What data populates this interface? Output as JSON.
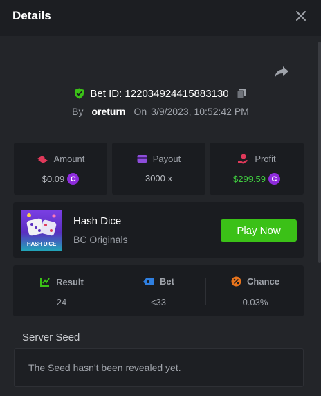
{
  "header": {
    "title": "Details"
  },
  "bet": {
    "id_label": "Bet ID: 122034924415883130",
    "by_label": "By",
    "user": "oreturn",
    "on_label": "On",
    "datetime": "3/9/2023, 10:52:42 PM"
  },
  "stats": {
    "amount_label": "Amount",
    "amount_value": "$0.09",
    "payout_label": "Payout",
    "payout_value": "3000 x",
    "profit_label": "Profit",
    "profit_value": "$299.59"
  },
  "game": {
    "name": "Hash Dice",
    "provider": "BC Originals",
    "thumb_text": "HASH DICE",
    "play_label": "Play Now"
  },
  "result": {
    "result_label": "Result",
    "result_value": "24",
    "bet_label": "Bet",
    "bet_value": "<33",
    "chance_label": "Chance",
    "chance_value": "0.03%"
  },
  "seed": {
    "title": "Server Seed",
    "text": "The Seed hasn't been revealed yet."
  },
  "icons": {
    "close": "close-icon",
    "share": "share-icon",
    "shield": "shield-check-icon",
    "copy": "copy-icon",
    "coin": "coin-icon"
  },
  "colors": {
    "accent_green": "#3bc117",
    "profit_green": "#3fcc3f",
    "coin_purple": "#8e2bdc"
  }
}
